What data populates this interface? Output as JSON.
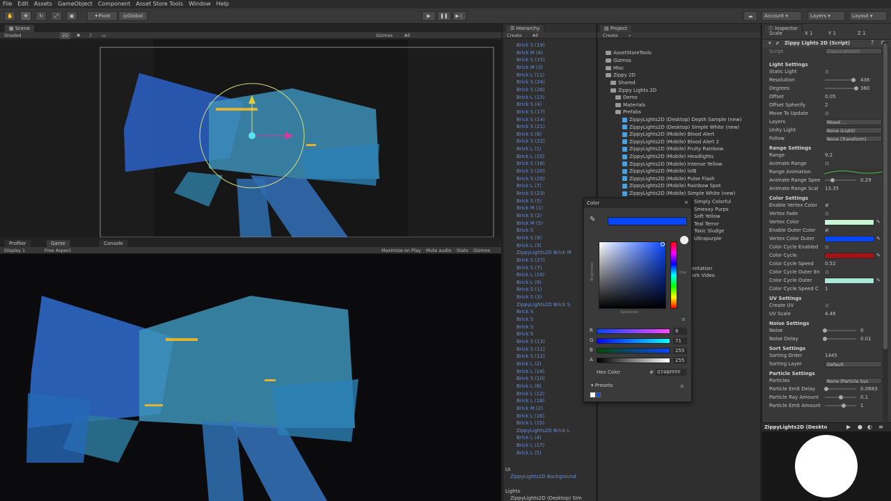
{
  "menu": [
    "File",
    "Edit",
    "Assets",
    "GameObject",
    "Component",
    "Asset Store Tools",
    "Window",
    "Help"
  ],
  "toolbar": {
    "pivot": "Pivot",
    "global": "Global",
    "account": "Account",
    "layers": "Layers",
    "layout": "Layout"
  },
  "scene": {
    "tab": "Scene",
    "shaded": "Shaded",
    "mode_2d": "2D",
    "gizmos": "Gizmos",
    "search": "All"
  },
  "game": {
    "tabs": [
      "Profiler",
      "Game",
      "Console"
    ],
    "display": "Display 1",
    "aspect": "Free Aspect",
    "maximize": "Maximize on Play",
    "mute": "Mute audio",
    "stats": "Stats",
    "gizmos": "Gizmos"
  },
  "hierarchy": {
    "tab": "Hierarchy",
    "create": "Create",
    "search": "All",
    "items": [
      "Brick S (19)",
      "Brick M (4)",
      "Brick S (15)",
      "Brick M (3)",
      "Brick L (11)",
      "Brick S (24)",
      "Brick S (26)",
      "Brick L (13)",
      "Brick S (4)",
      "Brick S (17)",
      "Brick S (14)",
      "Brick S (21)",
      "Brick S (6)",
      "Brick S (22)",
      "Brick L (1)",
      "Brick L (10)",
      "Brick S (16)",
      "Brick S (20)",
      "Brick S (25)",
      "Brick L (7)",
      "Brick S (23)",
      "Brick S (5)",
      "Brick M (1)",
      "Brick S (2)",
      "Brick M (5)",
      "Brick S",
      "Brick S (9)",
      "Brick L (3)",
      "ZippyLights2D Brick M",
      "Brick S (27)",
      "Brick S (7)",
      "Brick L (19)",
      "Brick L (9)",
      "Brick S (1)",
      "Brick S (3)",
      "ZippyLights2D Brick S",
      "Brick S",
      "Brick S",
      "Brick S",
      "Brick S",
      "Brick S (13)",
      "Brick S (11)",
      "Brick S (12)",
      "Brick L (2)",
      "Brick L (14)",
      "Brick S (10)",
      "Brick L (6)",
      "Brick L (12)",
      "Brick L (18)",
      "Brick M (2)",
      "Brick L (16)",
      "Brick L (15)",
      "ZippyLights2D Brick L",
      "Brick L (4)",
      "Brick L (17)",
      "Brick L (5)"
    ],
    "ui": "UI",
    "ui_child": "ZippyLights2D Background",
    "lights": "Lights",
    "lights_child": "ZippyLights2D (Desktop) Sim"
  },
  "project": {
    "tab": "Project",
    "create": "Create",
    "folders": [
      "AssetStoreTools",
      "Gizmos",
      "Misc",
      "Zippy 2D",
      "Shared",
      "Zippy Lights 2D",
      "Demo",
      "Materials",
      "Prefabs"
    ],
    "prefabs": [
      "ZippyLights2D (Desktop) Depth Sample (new)",
      "ZippyLights2D (Desktop) Simple White (new)",
      "ZippyLights2D (Mobile) Blood Alert",
      "ZippyLights2D (Mobile) Blood Alert 2",
      "ZippyLights2D (Mobile) Fruity Rainbow",
      "ZippyLights2D (Mobile) Headlights",
      "ZippyLights2D (Mobile) Intense Yellow",
      "ZippyLights2D (Mobile) lolB",
      "ZippyLights2D (Mobile) Pulse Flash",
      "ZippyLights2D (Mobile) Rainbow Spot",
      "ZippyLights2D (Mobile) Simple White (new)"
    ],
    "more": [
      "Simply Colorful",
      "Smexxy Purps",
      "Soft Yellow",
      "Teal Terror",
      "Toxic Sludge",
      "Ultrapurple"
    ],
    "more2": [
      "entation",
      "ork Video"
    ]
  },
  "color_picker": {
    "title": "Color",
    "brightness": "Brightness",
    "saturation": "Saturation",
    "hue": "Hue",
    "channels": [
      {
        "label": "R",
        "value": "8"
      },
      {
        "label": "G",
        "value": "71"
      },
      {
        "label": "B",
        "value": "255"
      },
      {
        "label": "A",
        "value": "255"
      }
    ],
    "hex_label": "Hex Color",
    "hex_prefix": "#",
    "hex_value": "0746FFFF",
    "presets": "Presets",
    "current_color": "#0746ff"
  },
  "inspector": {
    "tab": "Inspector",
    "scale": "Scale",
    "scale_x": "X 1",
    "scale_y": "Y 1",
    "scale_z": "Z 1",
    "component": "Zippy Lights 2D (Script)",
    "script_label": "Script",
    "script_value": "ZippyLights2D",
    "rows": [
      {
        "type": "head",
        "label": "Light Settings"
      },
      {
        "type": "check",
        "label": "Static Light",
        "checked": false
      },
      {
        "type": "slider",
        "label": "Resolution",
        "value": "436",
        "fraction": 0.9
      },
      {
        "type": "slider",
        "label": "Degrees",
        "value": "360",
        "fraction": 1.0
      },
      {
        "type": "text",
        "label": "Offset",
        "value": "0.05"
      },
      {
        "type": "text",
        "label": "Offset Spherify",
        "value": "2"
      },
      {
        "type": "check",
        "label": "Move To Update",
        "checked": false
      },
      {
        "type": "dropdown",
        "label": "Layers",
        "value": "Mixed ..."
      },
      {
        "type": "dropdown",
        "label": "Unity Light",
        "value": "None (Light)"
      },
      {
        "type": "dropdown",
        "label": "Follow",
        "value": "None (Transform)"
      },
      {
        "type": "head",
        "label": "Range Settings"
      },
      {
        "type": "text",
        "label": "Range",
        "value": "9.2"
      },
      {
        "type": "check",
        "label": "Animate Range",
        "checked": false
      },
      {
        "type": "curve",
        "label": "Range Animation"
      },
      {
        "type": "slider",
        "label": "Animate Range Spee",
        "value": "0.29",
        "fraction": 0.25
      },
      {
        "type": "text",
        "label": "Animate Range Scal",
        "value": "13.35"
      },
      {
        "type": "head",
        "label": "Color Settings"
      },
      {
        "type": "check",
        "label": "Enable Vertex Color",
        "checked": true
      },
      {
        "type": "check",
        "label": "Vertex Fade",
        "checked": false
      },
      {
        "type": "color",
        "label": "Vertex Color",
        "value": "#c8f5d6"
      },
      {
        "type": "check",
        "label": "Enable Outer Color",
        "checked": true
      },
      {
        "type": "color",
        "label": "Vertex Color Outer",
        "value": "#0746ff"
      },
      {
        "type": "check",
        "label": "Color Cycle Enabled",
        "checked": false
      },
      {
        "type": "color",
        "label": "Color Cycle",
        "value": "#a01418"
      },
      {
        "type": "text",
        "label": "Color Cycle Speed",
        "value": "0.52"
      },
      {
        "type": "check",
        "label": "Color Cycle Outer En",
        "checked": false
      },
      {
        "type": "color",
        "label": "Color Cycle Outer",
        "value": "#a8e8d4"
      },
      {
        "type": "text",
        "label": "Color Cycle Speed C",
        "value": "1"
      },
      {
        "type": "head",
        "label": "UV Settings"
      },
      {
        "type": "check",
        "label": "Create UV",
        "checked": false
      },
      {
        "type": "text",
        "label": "UV Scale",
        "value": "4.46"
      },
      {
        "type": "head",
        "label": "Noise Settings"
      },
      {
        "type": "slider",
        "label": "Noise",
        "value": "0",
        "fraction": 0.0
      },
      {
        "type": "slider",
        "label": "Noise Delay",
        "value": "0.01",
        "fraction": 0.0
      },
      {
        "type": "head",
        "label": "Sort Settings"
      },
      {
        "type": "text",
        "label": "Sorting Order",
        "value": "1445"
      },
      {
        "type": "dropdown",
        "label": "Sorting Layer",
        "value": "Default"
      },
      {
        "type": "head",
        "label": "Particle Settings"
      },
      {
        "type": "dropdown",
        "label": "Particles",
        "value": "None (Particle Sys"
      },
      {
        "type": "slider",
        "label": "Particle Emit Delay",
        "value": "0.0683",
        "fraction": 0.05
      },
      {
        "type": "slider",
        "label": "Particle Ray Amount",
        "value": "0.1",
        "fraction": 0.5
      },
      {
        "type": "slider",
        "label": "Particle Emit Amount",
        "value": "1",
        "fraction": 0.6
      }
    ],
    "preview_title": "ZippyLights2D (Deskto"
  },
  "colors": {
    "accent_blue": "#0746ff",
    "link_blue": "#6a8ed6",
    "panel": "#383838"
  }
}
